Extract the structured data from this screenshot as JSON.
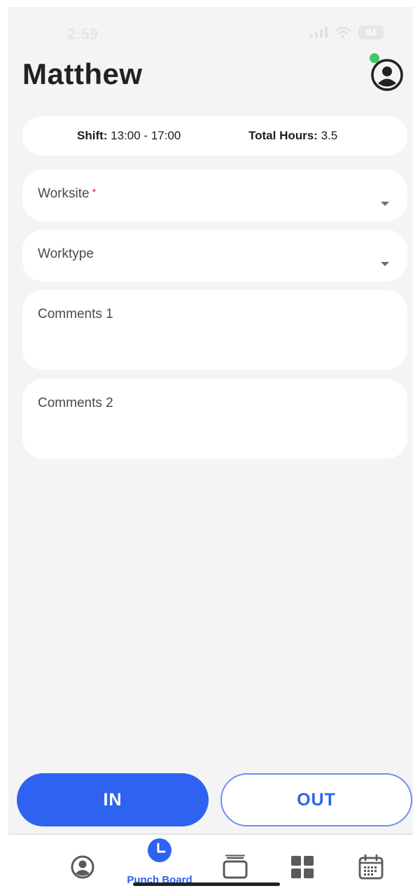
{
  "status_bar": {
    "time": "2:59",
    "battery": "84"
  },
  "header": {
    "title": "Matthew"
  },
  "shift": {
    "shift_label": "Shift:",
    "shift_value": "13:00 - 17:00",
    "hours_label": "Total Hours:",
    "hours_value": "3.5"
  },
  "form": {
    "worksite_label": "Worksite",
    "required_mark": "*",
    "worktype_label": "Worktype",
    "comments1_label": "Comments 1",
    "comments2_label": "Comments 2"
  },
  "actions": {
    "in_label": "IN",
    "out_label": "OUT"
  },
  "tabs": [
    {
      "icon": "profile-icon"
    },
    {
      "icon": "clock-icon",
      "label": "Punch Board",
      "active": true
    },
    {
      "icon": "cards-stack-icon"
    },
    {
      "icon": "grid-icon"
    },
    {
      "icon": "calendar-icon"
    }
  ],
  "colors": {
    "accent": "#2d63f0",
    "background": "#f4f4f4",
    "card": "#ffffff",
    "required": "#e02020",
    "online": "#3ec86a",
    "icon_gray": "#5a5a5a"
  }
}
